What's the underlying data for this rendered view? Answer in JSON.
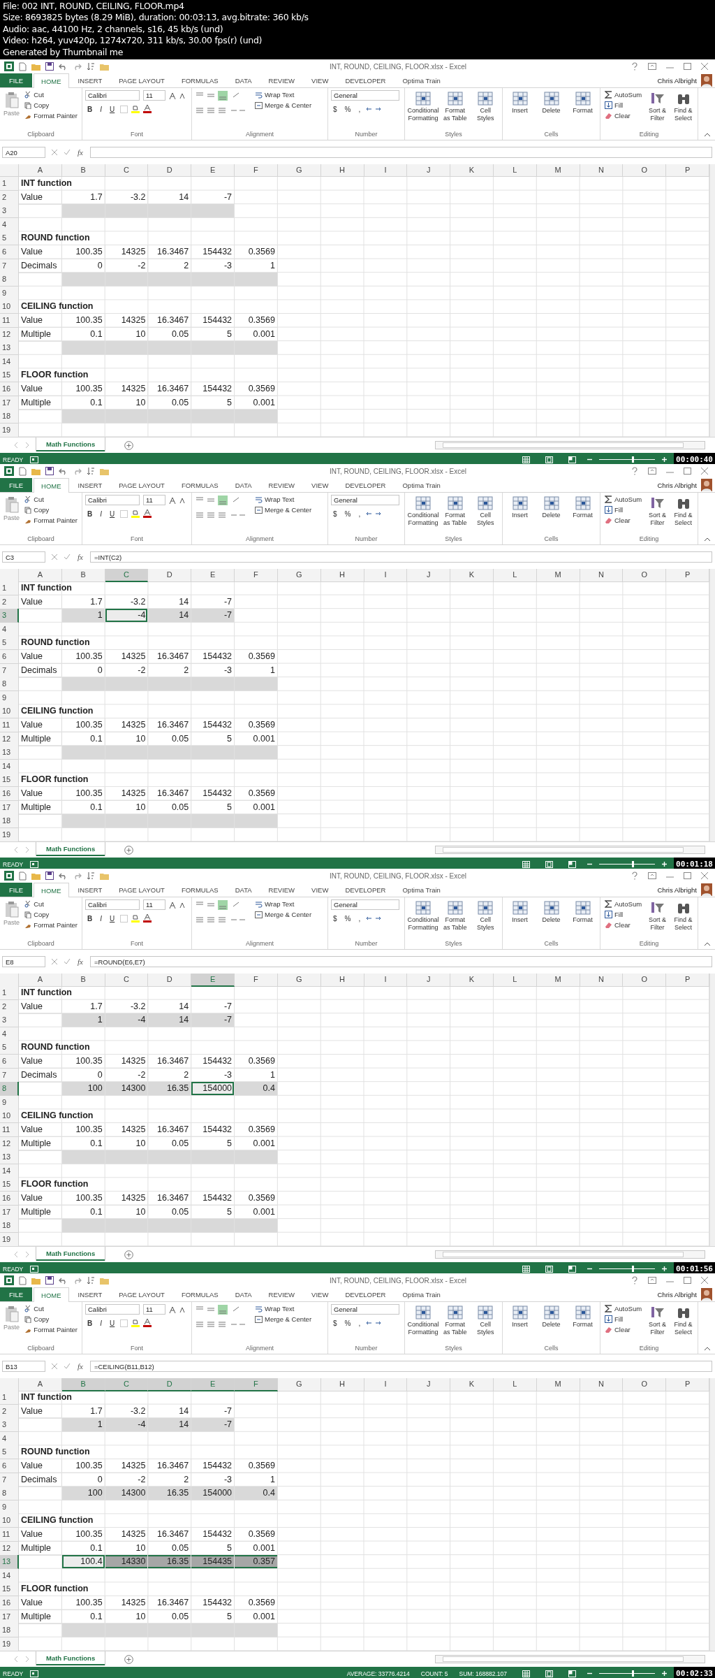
{
  "header": [
    "File: 002 INT, ROUND, CEILING, FLOOR.mp4",
    "Size: 8693825 bytes (8.29 MiB), duration: 00:03:13, avg.bitrate: 360 kb/s",
    "Audio: aac, 44100 Hz, 2 channels, s16, 45 kb/s (und)",
    "Video: h264, yuv420p, 1274x720, 311 kb/s, 30.00 fps(r) (und)",
    "Generated by Thumbnail me"
  ],
  "frames": [
    {
      "title": "INT, ROUND, CEILING, FLOOR.xlsx - Excel",
      "user": "Chris Albright",
      "tabs": [
        {
          "label": "FILE",
          "kind": "file",
          "selected": false
        },
        {
          "label": "HOME",
          "kind": "tab",
          "selected": true
        },
        {
          "label": "INSERT",
          "kind": "tab",
          "selected": false
        },
        {
          "label": "PAGE LAYOUT",
          "kind": "tab",
          "selected": false
        },
        {
          "label": "FORMULAS",
          "kind": "tab",
          "selected": false
        },
        {
          "label": "DATA",
          "kind": "tab",
          "selected": false
        },
        {
          "label": "REVIEW",
          "kind": "tab",
          "selected": false
        },
        {
          "label": "VIEW",
          "kind": "tab",
          "selected": false
        },
        {
          "label": "DEVELOPER",
          "kind": "tab",
          "selected": false
        },
        {
          "label": "Optima Train",
          "kind": "tab",
          "selected": false
        }
      ],
      "ribbon": [
        {
          "kind": "clipboard",
          "label": "Clipboard",
          "items": [
            "Paste",
            "Cut",
            "Copy",
            "Format Painter"
          ]
        },
        {
          "kind": "font",
          "label": "Font",
          "items": [
            "Calibri",
            "11",
            "B",
            "I",
            "U"
          ]
        },
        {
          "kind": "alignment",
          "label": "Alignment",
          "items": [
            "Wrap Text",
            "Merge & Center"
          ]
        },
        {
          "kind": "number",
          "label": "Number",
          "items": [
            "General",
            "$",
            "%",
            ","
          ]
        },
        {
          "kind": "big",
          "label": "Styles",
          "items": [
            "Conditional Formatting",
            "Format as Table",
            "Cell Styles"
          ]
        },
        {
          "kind": "big",
          "label": "Cells",
          "items": [
            "Insert",
            "Delete",
            "Format"
          ]
        },
        {
          "kind": "editing",
          "label": "Editing",
          "items": [
            "AutoSum",
            "Fill",
            "Clear",
            "Sort & Filter",
            "Find & Select"
          ]
        }
      ],
      "formula_bar": {
        "name_box": "A20",
        "fx": "fx"
      },
      "columns": [
        {
          "label": "A",
          "selected": false
        },
        {
          "label": "B",
          "selected": false
        },
        {
          "label": "C",
          "selected": false
        },
        {
          "label": "D",
          "selected": false
        },
        {
          "label": "E",
          "selected": false
        },
        {
          "label": "F",
          "selected": false
        },
        {
          "label": "G",
          "selected": false
        },
        {
          "label": "H",
          "selected": false
        },
        {
          "label": "I",
          "selected": false
        },
        {
          "label": "J",
          "selected": false
        },
        {
          "label": "K",
          "selected": false
        },
        {
          "label": "L",
          "selected": false
        },
        {
          "label": "M",
          "selected": false
        },
        {
          "label": "N",
          "selected": false
        },
        {
          "label": "O",
          "selected": false
        },
        {
          "label": "P",
          "selected": false
        }
      ],
      "rows": [
        {
          "number": "1",
          "selected": false,
          "kind": "heading",
          "cells": [
            "INT function"
          ]
        },
        {
          "number": "2",
          "selected": false,
          "kind": "data",
          "cells": [
            "Value",
            "1.7",
            "-3.2",
            "14",
            "-7"
          ]
        },
        {
          "number": "3",
          "selected": false,
          "kind": "result",
          "values": [
            {
              "selected": false,
              "active": false
            },
            {
              "selected": false,
              "active": false
            },
            {
              "selected": false,
              "active": false
            },
            {
              "selected": false,
              "active": false
            }
          ]
        },
        {
          "number": "4",
          "selected": false,
          "kind": "empty"
        },
        {
          "number": "5",
          "selected": false,
          "kind": "heading",
          "cells": [
            "ROUND function"
          ]
        },
        {
          "number": "6",
          "selected": false,
          "kind": "data",
          "cells": [
            "Value",
            "100.35",
            "14325",
            "16.3467",
            "154432",
            "0.3569"
          ]
        },
        {
          "number": "7",
          "selected": false,
          "kind": "data",
          "cells": [
            "Decimals",
            "0",
            "-2",
            "2",
            "-3",
            "1"
          ]
        },
        {
          "number": "8",
          "selected": false,
          "kind": "result",
          "values": [
            {
              "selected": false,
              "active": false
            },
            {
              "selected": false,
              "active": false
            },
            {
              "selected": false,
              "active": false
            },
            {
              "selected": false,
              "active": false
            },
            {
              "selected": false,
              "active": false
            }
          ]
        },
        {
          "number": "9",
          "selected": false,
          "kind": "empty"
        },
        {
          "number": "10",
          "selected": false,
          "kind": "heading",
          "cells": [
            "CEILING function"
          ]
        },
        {
          "number": "11",
          "selected": false,
          "kind": "data",
          "cells": [
            "Value",
            "100.35",
            "14325",
            "16.3467",
            "154432",
            "0.3569"
          ]
        },
        {
          "number": "12",
          "selected": false,
          "kind": "data",
          "cells": [
            "Multiple",
            "0.1",
            "10",
            "0.05",
            "5",
            "0.001"
          ]
        },
        {
          "number": "13",
          "selected": false,
          "kind": "result",
          "values": [
            {
              "selected": false,
              "active": false
            },
            {
              "selected": false,
              "active": false
            },
            {
              "selected": false,
              "active": false
            },
            {
              "selected": false,
              "active": false
            },
            {
              "selected": false,
              "active": false
            }
          ]
        },
        {
          "number": "14",
          "selected": false,
          "kind": "empty"
        },
        {
          "number": "15",
          "selected": false,
          "kind": "heading",
          "cells": [
            "FLOOR function"
          ]
        },
        {
          "number": "16",
          "selected": false,
          "kind": "data",
          "cells": [
            "Value",
            "100.35",
            "14325",
            "16.3467",
            "154432",
            "0.3569"
          ]
        },
        {
          "number": "17",
          "selected": false,
          "kind": "data",
          "cells": [
            "Multiple",
            "0.1",
            "10",
            "0.05",
            "5",
            "0.001"
          ]
        },
        {
          "number": "18",
          "selected": false,
          "kind": "result",
          "values": [
            {
              "selected": false,
              "active": false
            },
            {
              "selected": false,
              "active": false
            },
            {
              "selected": false,
              "active": false
            },
            {
              "selected": false,
              "active": false
            },
            {
              "selected": false,
              "active": false
            }
          ]
        },
        {
          "number": "19",
          "selected": false,
          "kind": "empty"
        }
      ],
      "sheet_tabs": [
        {
          "label": "Math Functions",
          "selected": true
        }
      ],
      "status": {
        "mode": "READY",
        "zoom": {
          "level": 0.6
        },
        "timestamp": "00:00:40"
      }
    },
    {
      "title": "INT, ROUND, CEILING, FLOOR.xlsx - Excel",
      "user": "Chris Albright",
      "tabs": [
        {
          "label": "FILE",
          "kind": "file",
          "selected": false
        },
        {
          "label": "HOME",
          "kind": "tab",
          "selected": true
        },
        {
          "label": "INSERT",
          "kind": "tab",
          "selected": false
        },
        {
          "label": "PAGE LAYOUT",
          "kind": "tab",
          "selected": false
        },
        {
          "label": "FORMULAS",
          "kind": "tab",
          "selected": false
        },
        {
          "label": "DATA",
          "kind": "tab",
          "selected": false
        },
        {
          "label": "REVIEW",
          "kind": "tab",
          "selected": false
        },
        {
          "label": "VIEW",
          "kind": "tab",
          "selected": false
        },
        {
          "label": "DEVELOPER",
          "kind": "tab",
          "selected": false
        },
        {
          "label": "Optima Train",
          "kind": "tab",
          "selected": false
        }
      ],
      "ribbon": [
        {
          "kind": "clipboard",
          "label": "Clipboard",
          "items": [
            "Paste",
            "Cut",
            "Copy",
            "Format Painter"
          ]
        },
        {
          "kind": "font",
          "label": "Font",
          "items": [
            "Calibri",
            "11",
            "B",
            "I",
            "U"
          ]
        },
        {
          "kind": "alignment",
          "label": "Alignment",
          "items": [
            "Wrap Text",
            "Merge & Center"
          ]
        },
        {
          "kind": "number",
          "label": "Number",
          "items": [
            "General",
            "$",
            "%",
            ","
          ]
        },
        {
          "kind": "big",
          "label": "Styles",
          "items": [
            "Conditional Formatting",
            "Format as Table",
            "Cell Styles"
          ]
        },
        {
          "kind": "big",
          "label": "Cells",
          "items": [
            "Insert",
            "Delete",
            "Format"
          ]
        },
        {
          "kind": "editing",
          "label": "Editing",
          "items": [
            "AutoSum",
            "Fill",
            "Clear",
            "Sort & Filter",
            "Find & Select"
          ]
        }
      ],
      "formula_bar": {
        "name_box": "C3",
        "fx": "fx",
        "formula": "=INT(C2)"
      },
      "columns": [
        {
          "label": "A",
          "selected": false
        },
        {
          "label": "B",
          "selected": false
        },
        {
          "label": "C",
          "selected": true
        },
        {
          "label": "D",
          "selected": false
        },
        {
          "label": "E",
          "selected": false
        },
        {
          "label": "F",
          "selected": false
        },
        {
          "label": "G",
          "selected": false
        },
        {
          "label": "H",
          "selected": false
        },
        {
          "label": "I",
          "selected": false
        },
        {
          "label": "J",
          "selected": false
        },
        {
          "label": "K",
          "selected": false
        },
        {
          "label": "L",
          "selected": false
        },
        {
          "label": "M",
          "selected": false
        },
        {
          "label": "N",
          "selected": false
        },
        {
          "label": "O",
          "selected": false
        },
        {
          "label": "P",
          "selected": false
        }
      ],
      "rows": [
        {
          "number": "1",
          "selected": false,
          "kind": "heading",
          "cells": [
            "INT function"
          ]
        },
        {
          "number": "2",
          "selected": false,
          "kind": "data",
          "cells": [
            "Value",
            "1.7",
            "-3.2",
            "14",
            "-7"
          ]
        },
        {
          "number": "3",
          "selected": true,
          "kind": "result",
          "values": [
            {
              "text": "1",
              "selected": false,
              "active": false
            },
            {
              "text": "-4",
              "selected": true,
              "active": true
            },
            {
              "text": "14",
              "selected": false,
              "active": false
            },
            {
              "text": "-7",
              "selected": false,
              "active": false
            }
          ]
        },
        {
          "number": "4",
          "selected": false,
          "kind": "empty"
        },
        {
          "number": "5",
          "selected": false,
          "kind": "heading",
          "cells": [
            "ROUND function"
          ]
        },
        {
          "number": "6",
          "selected": false,
          "kind": "data",
          "cells": [
            "Value",
            "100.35",
            "14325",
            "16.3467",
            "154432",
            "0.3569"
          ]
        },
        {
          "number": "7",
          "selected": false,
          "kind": "data",
          "cells": [
            "Decimals",
            "0",
            "-2",
            "2",
            "-3",
            "1"
          ]
        },
        {
          "number": "8",
          "selected": false,
          "kind": "result",
          "values": [
            {
              "selected": false,
              "active": false
            },
            {
              "selected": false,
              "active": false
            },
            {
              "selected": false,
              "active": false
            },
            {
              "selected": false,
              "active": false
            },
            {
              "selected": false,
              "active": false
            }
          ]
        },
        {
          "number": "9",
          "selected": false,
          "kind": "empty"
        },
        {
          "number": "10",
          "selected": false,
          "kind": "heading",
          "cells": [
            "CEILING function"
          ]
        },
        {
          "number": "11",
          "selected": false,
          "kind": "data",
          "cells": [
            "Value",
            "100.35",
            "14325",
            "16.3467",
            "154432",
            "0.3569"
          ]
        },
        {
          "number": "12",
          "selected": false,
          "kind": "data",
          "cells": [
            "Multiple",
            "0.1",
            "10",
            "0.05",
            "5",
            "0.001"
          ]
        },
        {
          "number": "13",
          "selected": false,
          "kind": "result",
          "values": [
            {
              "selected": false,
              "active": false
            },
            {
              "selected": false,
              "active": false
            },
            {
              "selected": false,
              "active": false
            },
            {
              "selected": false,
              "active": false
            },
            {
              "selected": false,
              "active": false
            }
          ]
        },
        {
          "number": "14",
          "selected": false,
          "kind": "empty"
        },
        {
          "number": "15",
          "selected": false,
          "kind": "heading",
          "cells": [
            "FLOOR function"
          ]
        },
        {
          "number": "16",
          "selected": false,
          "kind": "data",
          "cells": [
            "Value",
            "100.35",
            "14325",
            "16.3467",
            "154432",
            "0.3569"
          ]
        },
        {
          "number": "17",
          "selected": false,
          "kind": "data",
          "cells": [
            "Multiple",
            "0.1",
            "10",
            "0.05",
            "5",
            "0.001"
          ]
        },
        {
          "number": "18",
          "selected": false,
          "kind": "result",
          "values": [
            {
              "selected": false,
              "active": false
            },
            {
              "selected": false,
              "active": false
            },
            {
              "selected": false,
              "active": false
            },
            {
              "selected": false,
              "active": false
            },
            {
              "selected": false,
              "active": false
            }
          ]
        },
        {
          "number": "19",
          "selected": false,
          "kind": "empty"
        }
      ],
      "sheet_tabs": [
        {
          "label": "Math Functions",
          "selected": true
        }
      ],
      "status": {
        "mode": "READY",
        "zoom": {
          "level": 0.6
        },
        "timestamp": "00:01:18"
      }
    },
    {
      "title": "INT, ROUND, CEILING, FLOOR.xlsx - Excel",
      "user": "Chris Albright",
      "tabs": [
        {
          "label": "FILE",
          "kind": "file",
          "selected": false
        },
        {
          "label": "HOME",
          "kind": "tab",
          "selected": true
        },
        {
          "label": "INSERT",
          "kind": "tab",
          "selected": false
        },
        {
          "label": "PAGE LAYOUT",
          "kind": "tab",
          "selected": false
        },
        {
          "label": "FORMULAS",
          "kind": "tab",
          "selected": false
        },
        {
          "label": "DATA",
          "kind": "tab",
          "selected": false
        },
        {
          "label": "REVIEW",
          "kind": "tab",
          "selected": false
        },
        {
          "label": "VIEW",
          "kind": "tab",
          "selected": false
        },
        {
          "label": "DEVELOPER",
          "kind": "tab",
          "selected": false
        },
        {
          "label": "Optima Train",
          "kind": "tab",
          "selected": false
        }
      ],
      "ribbon": [
        {
          "kind": "clipboard",
          "label": "Clipboard",
          "items": [
            "Paste",
            "Cut",
            "Copy",
            "Format Painter"
          ]
        },
        {
          "kind": "font",
          "label": "Font",
          "items": [
            "Calibri",
            "11",
            "B",
            "I",
            "U"
          ]
        },
        {
          "kind": "alignment",
          "label": "Alignment",
          "items": [
            "Wrap Text",
            "Merge & Center"
          ]
        },
        {
          "kind": "number",
          "label": "Number",
          "items": [
            "General",
            "$",
            "%",
            ","
          ]
        },
        {
          "kind": "big",
          "label": "Styles",
          "items": [
            "Conditional Formatting",
            "Format as Table",
            "Cell Styles"
          ]
        },
        {
          "kind": "big",
          "label": "Cells",
          "items": [
            "Insert",
            "Delete",
            "Format"
          ]
        },
        {
          "kind": "editing",
          "label": "Editing",
          "items": [
            "AutoSum",
            "Fill",
            "Clear",
            "Sort & Filter",
            "Find & Select"
          ]
        }
      ],
      "formula_bar": {
        "name_box": "E8",
        "fx": "fx",
        "formula": "=ROUND(E6,E7)"
      },
      "columns": [
        {
          "label": "A",
          "selected": false
        },
        {
          "label": "B",
          "selected": false
        },
        {
          "label": "C",
          "selected": false
        },
        {
          "label": "D",
          "selected": false
        },
        {
          "label": "E",
          "selected": true
        },
        {
          "label": "F",
          "selected": false
        },
        {
          "label": "G",
          "selected": false
        },
        {
          "label": "H",
          "selected": false
        },
        {
          "label": "I",
          "selected": false
        },
        {
          "label": "J",
          "selected": false
        },
        {
          "label": "K",
          "selected": false
        },
        {
          "label": "L",
          "selected": false
        },
        {
          "label": "M",
          "selected": false
        },
        {
          "label": "N",
          "selected": false
        },
        {
          "label": "O",
          "selected": false
        },
        {
          "label": "P",
          "selected": false
        }
      ],
      "rows": [
        {
          "number": "1",
          "selected": false,
          "kind": "heading",
          "cells": [
            "INT function"
          ]
        },
        {
          "number": "2",
          "selected": false,
          "kind": "data",
          "cells": [
            "Value",
            "1.7",
            "-3.2",
            "14",
            "-7"
          ]
        },
        {
          "number": "3",
          "selected": false,
          "kind": "result",
          "values": [
            {
              "text": "1",
              "selected": false,
              "active": false
            },
            {
              "text": "-4",
              "selected": false,
              "active": false
            },
            {
              "text": "14",
              "selected": false,
              "active": false
            },
            {
              "text": "-7",
              "selected": false,
              "active": false
            }
          ]
        },
        {
          "number": "4",
          "selected": false,
          "kind": "empty"
        },
        {
          "number": "5",
          "selected": false,
          "kind": "heading",
          "cells": [
            "ROUND function"
          ]
        },
        {
          "number": "6",
          "selected": false,
          "kind": "data",
          "cells": [
            "Value",
            "100.35",
            "14325",
            "16.3467",
            "154432",
            "0.3569"
          ]
        },
        {
          "number": "7",
          "selected": false,
          "kind": "data",
          "cells": [
            "Decimals",
            "0",
            "-2",
            "2",
            "-3",
            "1"
          ]
        },
        {
          "number": "8",
          "selected": true,
          "kind": "result",
          "values": [
            {
              "text": "100",
              "selected": false,
              "active": false
            },
            {
              "text": "14300",
              "selected": false,
              "active": false
            },
            {
              "text": "16.35",
              "selected": false,
              "active": false
            },
            {
              "text": "154000",
              "selected": true,
              "active": true
            },
            {
              "text": "0.4",
              "selected": false,
              "active": false
            }
          ]
        },
        {
          "number": "9",
          "selected": false,
          "kind": "empty"
        },
        {
          "number": "10",
          "selected": false,
          "kind": "heading",
          "cells": [
            "CEILING function"
          ]
        },
        {
          "number": "11",
          "selected": false,
          "kind": "data",
          "cells": [
            "Value",
            "100.35",
            "14325",
            "16.3467",
            "154432",
            "0.3569"
          ]
        },
        {
          "number": "12",
          "selected": false,
          "kind": "data",
          "cells": [
            "Multiple",
            "0.1",
            "10",
            "0.05",
            "5",
            "0.001"
          ]
        },
        {
          "number": "13",
          "selected": false,
          "kind": "result",
          "values": [
            {
              "selected": false,
              "active": false
            },
            {
              "selected": false,
              "active": false
            },
            {
              "selected": false,
              "active": false
            },
            {
              "selected": false,
              "active": false
            },
            {
              "selected": false,
              "active": false
            }
          ]
        },
        {
          "number": "14",
          "selected": false,
          "kind": "empty"
        },
        {
          "number": "15",
          "selected": false,
          "kind": "heading",
          "cells": [
            "FLOOR function"
          ]
        },
        {
          "number": "16",
          "selected": false,
          "kind": "data",
          "cells": [
            "Value",
            "100.35",
            "14325",
            "16.3467",
            "154432",
            "0.3569"
          ]
        },
        {
          "number": "17",
          "selected": false,
          "kind": "data",
          "cells": [
            "Multiple",
            "0.1",
            "10",
            "0.05",
            "5",
            "0.001"
          ]
        },
        {
          "number": "18",
          "selected": false,
          "kind": "result",
          "values": [
            {
              "selected": false,
              "active": false
            },
            {
              "selected": false,
              "active": false
            },
            {
              "selected": false,
              "active": false
            },
            {
              "selected": false,
              "active": false
            },
            {
              "selected": false,
              "active": false
            }
          ]
        },
        {
          "number": "19",
          "selected": false,
          "kind": "empty"
        }
      ],
      "sheet_tabs": [
        {
          "label": "Math Functions",
          "selected": true
        }
      ],
      "status": {
        "mode": "READY",
        "zoom": {
          "level": 0.6
        },
        "timestamp": "00:01:56"
      }
    },
    {
      "title": "INT, ROUND, CEILING, FLOOR.xlsx - Excel",
      "user": "Chris Albright",
      "tabs": [
        {
          "label": "FILE",
          "kind": "file",
          "selected": false
        },
        {
          "label": "HOME",
          "kind": "tab",
          "selected": true
        },
        {
          "label": "INSERT",
          "kind": "tab",
          "selected": false
        },
        {
          "label": "PAGE LAYOUT",
          "kind": "tab",
          "selected": false
        },
        {
          "label": "FORMULAS",
          "kind": "tab",
          "selected": false
        },
        {
          "label": "DATA",
          "kind": "tab",
          "selected": false
        },
        {
          "label": "REVIEW",
          "kind": "tab",
          "selected": false
        },
        {
          "label": "VIEW",
          "kind": "tab",
          "selected": false
        },
        {
          "label": "DEVELOPER",
          "kind": "tab",
          "selected": false
        },
        {
          "label": "Optima Train",
          "kind": "tab",
          "selected": false
        }
      ],
      "ribbon": [
        {
          "kind": "clipboard",
          "label": "Clipboard",
          "items": [
            "Paste",
            "Cut",
            "Copy",
            "Format Painter"
          ]
        },
        {
          "kind": "font",
          "label": "Font",
          "items": [
            "Calibri",
            "11",
            "B",
            "I",
            "U"
          ]
        },
        {
          "kind": "alignment",
          "label": "Alignment",
          "items": [
            "Wrap Text",
            "Merge & Center"
          ]
        },
        {
          "kind": "number",
          "label": "Number",
          "items": [
            "General",
            "$",
            "%",
            ","
          ]
        },
        {
          "kind": "big",
          "label": "Styles",
          "items": [
            "Conditional Formatting",
            "Format as Table",
            "Cell Styles"
          ]
        },
        {
          "kind": "big",
          "label": "Cells",
          "items": [
            "Insert",
            "Delete",
            "Format"
          ]
        },
        {
          "kind": "editing",
          "label": "Editing",
          "items": [
            "AutoSum",
            "Fill",
            "Clear",
            "Sort & Filter",
            "Find & Select"
          ]
        }
      ],
      "formula_bar": {
        "name_box": "B13",
        "fx": "fx",
        "formula": "=CEILING(B11,B12)"
      },
      "columns": [
        {
          "label": "A",
          "selected": false
        },
        {
          "label": "B",
          "selected": true
        },
        {
          "label": "C",
          "selected": true
        },
        {
          "label": "D",
          "selected": true
        },
        {
          "label": "E",
          "selected": true
        },
        {
          "label": "F",
          "selected": true
        },
        {
          "label": "G",
          "selected": false
        },
        {
          "label": "H",
          "selected": false
        },
        {
          "label": "I",
          "selected": false
        },
        {
          "label": "J",
          "selected": false
        },
        {
          "label": "K",
          "selected": false
        },
        {
          "label": "L",
          "selected": false
        },
        {
          "label": "M",
          "selected": false
        },
        {
          "label": "N",
          "selected": false
        },
        {
          "label": "O",
          "selected": false
        },
        {
          "label": "P",
          "selected": false
        }
      ],
      "rows": [
        {
          "number": "1",
          "selected": false,
          "kind": "heading",
          "cells": [
            "INT function"
          ]
        },
        {
          "number": "2",
          "selected": false,
          "kind": "data",
          "cells": [
            "Value",
            "1.7",
            "-3.2",
            "14",
            "-7"
          ]
        },
        {
          "number": "3",
          "selected": false,
          "kind": "result",
          "values": [
            {
              "text": "1",
              "selected": false,
              "active": false
            },
            {
              "text": "-4",
              "selected": false,
              "active": false
            },
            {
              "text": "14",
              "selected": false,
              "active": false
            },
            {
              "text": "-7",
              "selected": false,
              "active": false
            }
          ]
        },
        {
          "number": "4",
          "selected": false,
          "kind": "empty"
        },
        {
          "number": "5",
          "selected": false,
          "kind": "heading",
          "cells": [
            "ROUND function"
          ]
        },
        {
          "number": "6",
          "selected": false,
          "kind": "data",
          "cells": [
            "Value",
            "100.35",
            "14325",
            "16.3467",
            "154432",
            "0.3569"
          ]
        },
        {
          "number": "7",
          "selected": false,
          "kind": "data",
          "cells": [
            "Decimals",
            "0",
            "-2",
            "2",
            "-3",
            "1"
          ]
        },
        {
          "number": "8",
          "selected": false,
          "kind": "result",
          "values": [
            {
              "text": "100",
              "selected": false,
              "active": false
            },
            {
              "text": "14300",
              "selected": false,
              "active": false
            },
            {
              "text": "16.35",
              "selected": false,
              "active": false
            },
            {
              "text": "154000",
              "selected": false,
              "active": false
            },
            {
              "text": "0.4",
              "selected": false,
              "active": false
            }
          ]
        },
        {
          "number": "9",
          "selected": false,
          "kind": "empty"
        },
        {
          "number": "10",
          "selected": false,
          "kind": "heading",
          "cells": [
            "CEILING function"
          ]
        },
        {
          "number": "11",
          "selected": false,
          "kind": "data",
          "cells": [
            "Value",
            "100.35",
            "14325",
            "16.3467",
            "154432",
            "0.3569"
          ]
        },
        {
          "number": "12",
          "selected": false,
          "kind": "data",
          "cells": [
            "Multiple",
            "0.1",
            "10",
            "0.05",
            "5",
            "0.001"
          ]
        },
        {
          "number": "13",
          "selected": true,
          "kind": "result",
          "values": [
            {
              "text": "100.4",
              "selected": true,
              "active": true
            },
            {
              "text": "14330",
              "selected": true,
              "active": false
            },
            {
              "text": "16.35",
              "selected": true,
              "active": false
            },
            {
              "text": "154435",
              "selected": true,
              "active": false
            },
            {
              "text": "0.357",
              "selected": true,
              "active": false
            }
          ]
        },
        {
          "number": "14",
          "selected": false,
          "kind": "empty"
        },
        {
          "number": "15",
          "selected": false,
          "kind": "heading",
          "cells": [
            "FLOOR function"
          ]
        },
        {
          "number": "16",
          "selected": false,
          "kind": "data",
          "cells": [
            "Value",
            "100.35",
            "14325",
            "16.3467",
            "154432",
            "0.3569"
          ]
        },
        {
          "number": "17",
          "selected": false,
          "kind": "data",
          "cells": [
            "Multiple",
            "0.1",
            "10",
            "0.05",
            "5",
            "0.001"
          ]
        },
        {
          "number": "18",
          "selected": false,
          "kind": "result",
          "values": [
            {
              "selected": false,
              "active": false
            },
            {
              "selected": false,
              "active": false
            },
            {
              "selected": false,
              "active": false
            },
            {
              "selected": false,
              "active": false
            },
            {
              "selected": false,
              "active": false
            }
          ]
        },
        {
          "number": "19",
          "selected": false,
          "kind": "empty"
        }
      ],
      "sheet_tabs": [
        {
          "label": "Math Functions",
          "selected": true
        }
      ],
      "status": {
        "mode": "READY",
        "stats": [
          "AVERAGE: 33776.4214",
          "COUNT: 5",
          "SUM: 168882.107"
        ],
        "zoom": {
          "level": 0.6
        },
        "timestamp": "00:02:33"
      }
    }
  ]
}
